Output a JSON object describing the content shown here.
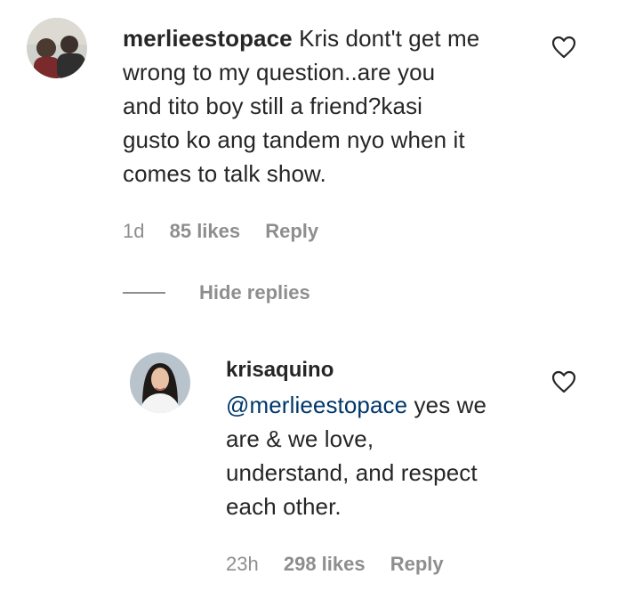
{
  "comment": {
    "username": "merlieestopace",
    "text": "Kris dont't get me wrong to my question..are you and tito boy still a friend?kasi gusto ko ang tandem nyo when it comes to talk show.",
    "lines": [
      "Kris dont't get me",
      "wrong to my question..are you",
      "and tito boy still a friend?kasi",
      "gusto ko ang tandem nyo when it",
      "comes to talk show."
    ],
    "time": "1d",
    "likes": "85 likes",
    "reply_label": "Reply",
    "heart_icon": "heart-outline-icon"
  },
  "hide_replies_label": "Hide replies",
  "reply": {
    "username": "krisaquino",
    "mention": "@merlieestopace",
    "lines": [
      "yes we",
      "are & we love,",
      "understand, and respect",
      "each other."
    ],
    "time": "23h",
    "likes": "298 likes",
    "reply_label": "Reply",
    "heart_icon": "heart-outline-icon"
  },
  "colors": {
    "text": "#262626",
    "secondary": "#8e8e8e",
    "mention": "#00376b",
    "background": "#ffffff"
  }
}
